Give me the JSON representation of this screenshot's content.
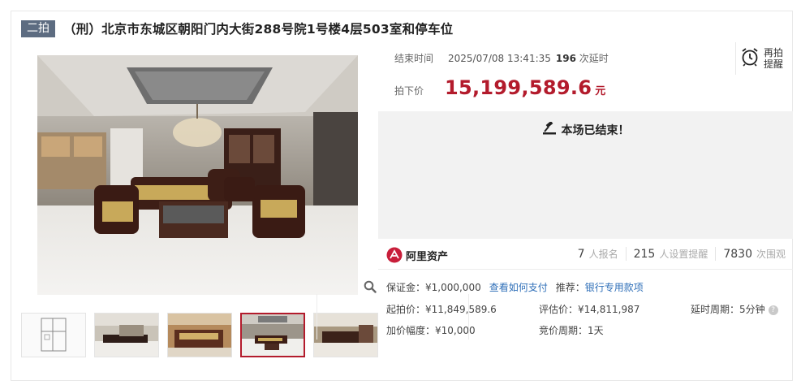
{
  "title": {
    "badge": "二拍",
    "text": "（刑）北京市东城区朝阳门内大街288号院1号楼4层503室和停车位"
  },
  "auction": {
    "end_label": "结束时间",
    "end_time": "2025/07/08 13:41:35",
    "delay_count": "196",
    "delay_label": "次延时",
    "price_label": "拍下价",
    "price": "15,199,589.6",
    "price_unit": "元",
    "remind_line1": "再拍",
    "remind_line2": "提醒",
    "ended_text": "本场已结束！"
  },
  "brand": {
    "name": "阿里资产"
  },
  "stats": {
    "signups": "7",
    "signups_label": "人报名",
    "reminders": "215",
    "reminders_label": "人设置提醒",
    "views": "7830",
    "views_label": "次围观"
  },
  "details": {
    "deposit": "保证金：¥1,000,000",
    "how_to_pay": "查看如何支付",
    "recommend_label": "推荐：",
    "recommend_link": "银行专用款项",
    "start_price": "起拍价：¥11,849,589.6",
    "appraisal": "评估价：¥14,811,987",
    "delay_period": "延时周期：5分钟",
    "increment": "加价幅度：¥10,000",
    "bid_period": "竞价周期：1天"
  },
  "icons": {
    "zoom": "magnifier-icon",
    "alarm": "alarm-clock-icon",
    "gavel": "gavel-icon",
    "help": "question-circle-icon",
    "logo": "ali-asset-logo"
  },
  "colors": {
    "accent": "#b31b2c",
    "badge": "#5d6c81",
    "link": "#2f6fb8"
  }
}
